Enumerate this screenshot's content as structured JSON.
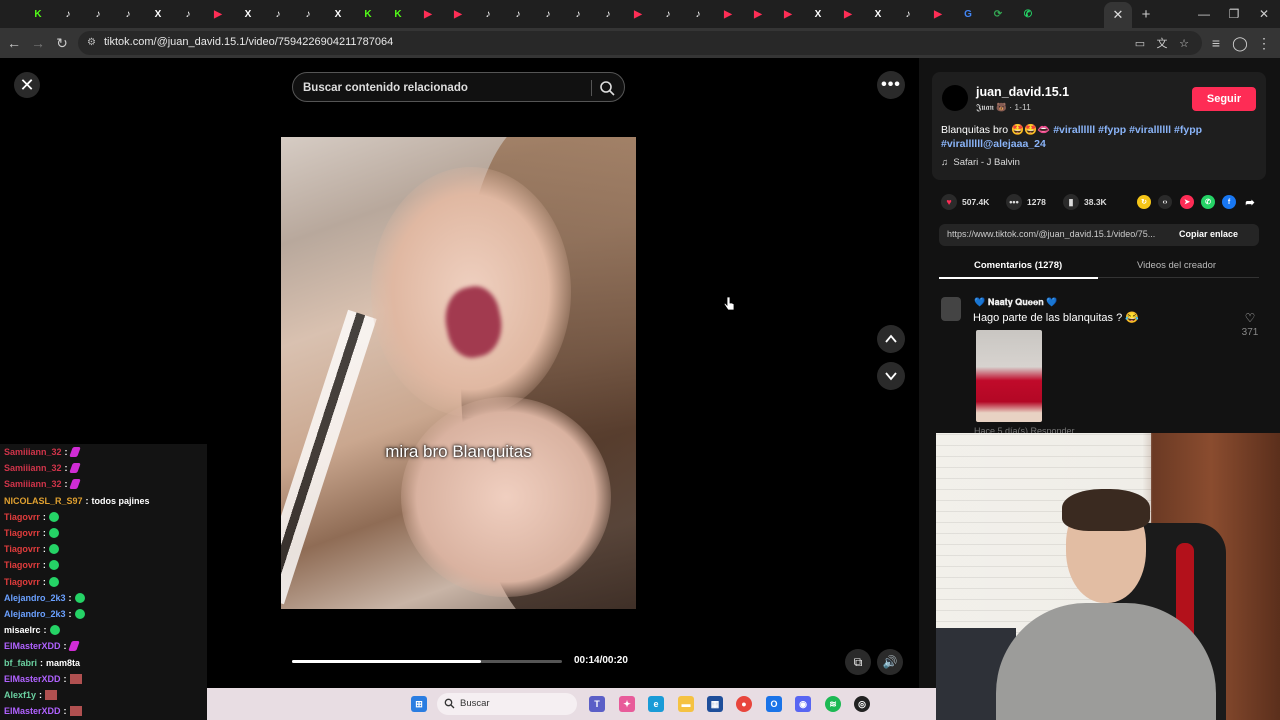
{
  "browser": {
    "tabs": [
      "K",
      "♪",
      "♪",
      "♪",
      "X",
      "♪",
      "▶",
      "X",
      "♪",
      "♪",
      "X",
      "K",
      "K",
      "▶",
      "▶",
      "♪",
      "♪",
      "♪",
      "♪",
      "♪",
      "▶",
      "♪",
      "♪",
      "▶",
      "▶",
      "▶",
      "X",
      "▶",
      "X",
      "♪",
      "▶",
      "G",
      "⟳",
      "✆"
    ],
    "active_tab_close": "✕",
    "url": "tiktok.com/@juan_david.15.1/video/7594226904211787064"
  },
  "player": {
    "search_placeholder": "Buscar contenido relacionado",
    "caption": "mira bro Blanquitas",
    "time": "00:14/00:20",
    "progress": 0.7
  },
  "post": {
    "username": "juan_david.15.1",
    "subtitle": "𝕵𝖚𝖆𝖓 🐻 · 1-11",
    "follow_label": "Seguir",
    "desc_text": "Blanquitas bro 🤩🤩👄",
    "tags": [
      "#virallllll",
      "#fypp",
      "#virallllll",
      "#fypp",
      "#virallllll@alejaaa_24"
    ],
    "music": "Safari - J Balvin",
    "likes": "507.4K",
    "comments": "1278",
    "saves": "38.3K",
    "link": "https://www.tiktok.com/@juan_david.15.1/video/75...",
    "copy_label": "Copiar enlace",
    "tab_comments": "Comentarios (1278)",
    "tab_creator": "Videos del creador"
  },
  "comment": {
    "user": "💙 𝐍𝐚𝐚𝐭𝐲 𝐐𝐮𝐞𝐞𝐧 💙",
    "text": "Hago parte de las blanquitas ? 😂",
    "likes": "371",
    "meta": "Hace 5 día(s)     Responder"
  },
  "chat": [
    {
      "user": "Samiiiann_32",
      "color": "#d0344a",
      "msg": "",
      "emote": "feather"
    },
    {
      "user": "Samiiiann_32",
      "color": "#d0344a",
      "msg": "",
      "emote": "feather"
    },
    {
      "user": "Samiiiann_32",
      "color": "#d0344a",
      "msg": "",
      "emote": "feather"
    },
    {
      "user": "NICOLASL_R_S97",
      "color": "#e0a030",
      "msg": "todos pajines",
      "emote": ""
    },
    {
      "user": "Tiagovrr",
      "color": "#e03c3c",
      "msg": "",
      "emote": "wa"
    },
    {
      "user": "Tiagovrr",
      "color": "#e03c3c",
      "msg": "",
      "emote": "wa"
    },
    {
      "user": "Tiagovrr",
      "color": "#e03c3c",
      "msg": "",
      "emote": "wa"
    },
    {
      "user": "Tiagovrr",
      "color": "#e03c3c",
      "msg": "",
      "emote": "wa"
    },
    {
      "user": "Tiagovrr",
      "color": "#e03c3c",
      "msg": "",
      "emote": "wa"
    },
    {
      "user": "Alejandro_2k3",
      "color": "#6aa0ff",
      "msg": "",
      "emote": "wa"
    },
    {
      "user": "Alejandro_2k3",
      "color": "#6aa0ff",
      "msg": "",
      "emote": "wa"
    },
    {
      "user": "misaelrc",
      "color": "#ffffff",
      "msg": "",
      "emote": "wa"
    },
    {
      "user": "ElMasterXDD",
      "color": "#b062ff",
      "msg": "",
      "emote": "feather"
    },
    {
      "user": "bf_fabri",
      "color": "#6ad0a0",
      "msg": "mam8ta",
      "emote": ""
    },
    {
      "user": "ElMasterXDD",
      "color": "#b062ff",
      "msg": "",
      "emote": "pic"
    },
    {
      "user": "Alexf1y",
      "color": "#6ad0a0",
      "msg": "",
      "emote": "pic"
    },
    {
      "user": "ElMasterXDD",
      "color": "#b062ff",
      "msg": "",
      "emote": "pic"
    }
  ],
  "taskbar": {
    "search_label": "Buscar"
  },
  "colors": {
    "accent": "#fe2c55",
    "tag": "#8ab4f8"
  }
}
